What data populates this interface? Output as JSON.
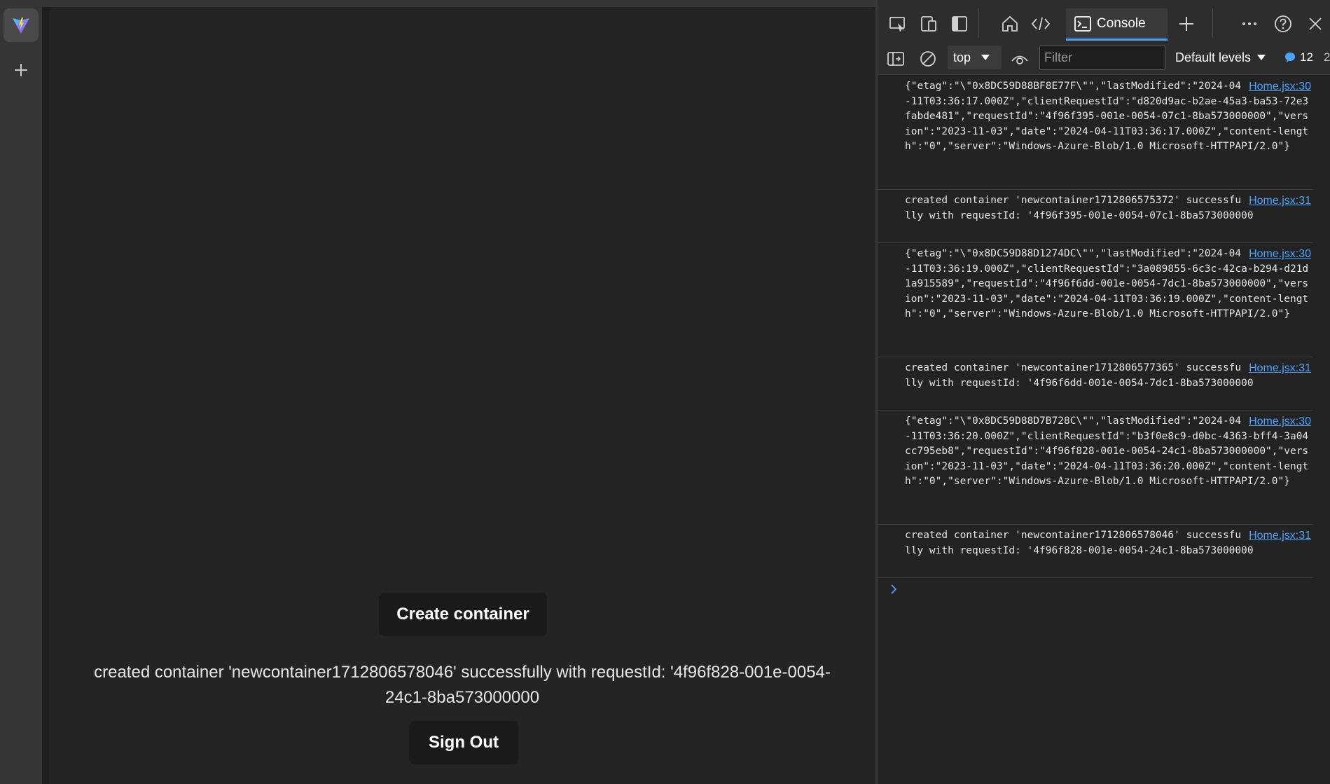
{
  "page": {
    "create_button": "Create container",
    "status_message": "created container 'newcontainer1712806578046' successfully with requestId: '4f96f828-001e-0054-24c1-8ba573000000",
    "signout_button": "Sign Out"
  },
  "devtools": {
    "tabs": {
      "console": "Console"
    },
    "filterbar": {
      "context": "top",
      "filter_placeholder": "Filter",
      "levels": "Default levels",
      "message_count": "12",
      "overflow_count": "2"
    },
    "console_logs": [
      {
        "text": "{\"etag\":\"\\\"0x8DC59D88BF8E77F\\\"\",\"lastModified\":\"2024-04-11T03:36:17.000Z\",\"clientRequestId\":\"d820d9ac-b2ae-45a3-ba53-72e3fabde481\",\"requestId\":\"4f96f395-001e-0054-07c1-8ba573000000\",\"version\":\"2023-11-03\",\"date\":\"2024-04-11T03:36:17.000Z\",\"content-length\":\"0\",\"server\":\"Windows-Azure-Blob/1.0 Microsoft-HTTPAPI/2.0\"}",
        "source": "Home.jsx:30"
      },
      {
        "text": "created container 'newcontainer1712806575372' successfully with requestId: '4f96f395-001e-0054-07c1-8ba573000000",
        "source": "Home.jsx:31"
      },
      {
        "text": "{\"etag\":\"\\\"0x8DC59D88D1274DC\\\"\",\"lastModified\":\"2024-04-11T03:36:19.000Z\",\"clientRequestId\":\"3a089855-6c3c-42ca-b294-d21d1a915589\",\"requestId\":\"4f96f6dd-001e-0054-7dc1-8ba573000000\",\"version\":\"2023-11-03\",\"date\":\"2024-04-11T03:36:19.000Z\",\"content-length\":\"0\",\"server\":\"Windows-Azure-Blob/1.0 Microsoft-HTTPAPI/2.0\"}",
        "source": "Home.jsx:30"
      },
      {
        "text": "created container 'newcontainer1712806577365' successfully with requestId: '4f96f6dd-001e-0054-7dc1-8ba573000000",
        "source": "Home.jsx:31"
      },
      {
        "text": "{\"etag\":\"\\\"0x8DC59D88D7B728C\\\"\",\"lastModified\":\"2024-04-11T03:36:20.000Z\",\"clientRequestId\":\"b3f0e8c9-d0bc-4363-bff4-3a04cc795eb8\",\"requestId\":\"4f96f828-001e-0054-24c1-8ba573000000\",\"version\":\"2023-11-03\",\"date\":\"2024-04-11T03:36:20.000Z\",\"content-length\":\"0\",\"server\":\"Windows-Azure-Blob/1.0 Microsoft-HTTPAPI/2.0\"}",
        "source": "Home.jsx:30"
      },
      {
        "text": "created container 'newcontainer1712806578046' successfully with requestId: '4f96f828-001e-0054-24c1-8ba573000000",
        "source": "Home.jsx:31"
      }
    ]
  },
  "colors": {
    "accent": "#4aa3ff",
    "page_bg": "#242424",
    "button_bg": "#1a1a1a"
  }
}
